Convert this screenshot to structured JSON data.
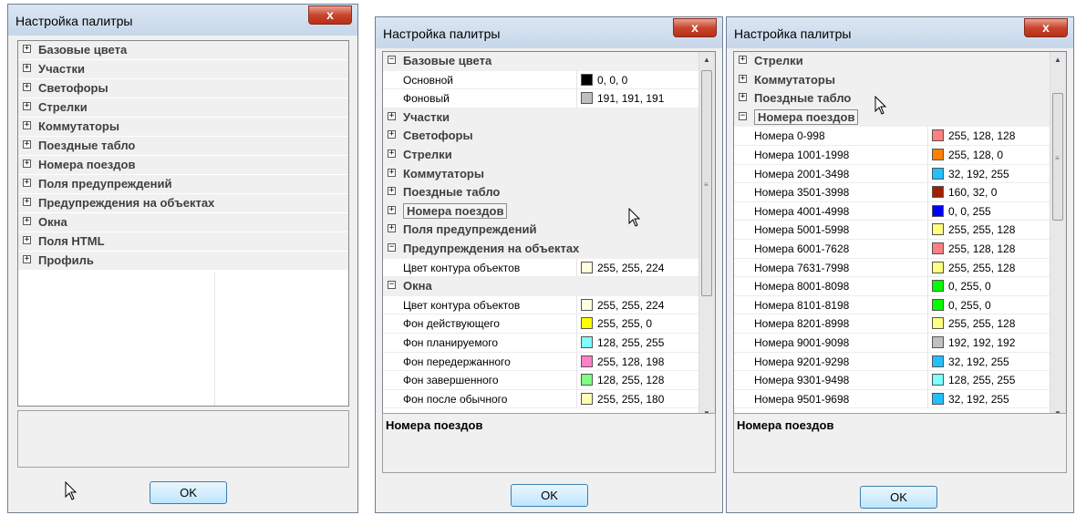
{
  "colors": {
    "title_bg": "#c6d7ea",
    "close_bg": "#c9452d",
    "button_bg": "#bee6fd",
    "panel_bg": "#f0f0f0"
  },
  "dialogs": [
    {
      "title": "Настройка палитры",
      "close_label": "x",
      "ok_label": "OK",
      "description": "",
      "categories": [
        "Базовые цвета",
        "Участки",
        "Светофоры",
        "Стрелки",
        "Коммутаторы",
        "Поездные табло",
        "Номера поездов",
        "Поля предупреждений",
        "Предупреждения на объектах",
        "Окна",
        "Поля HTML",
        "Профиль"
      ]
    },
    {
      "title": "Настройка палитры",
      "close_label": "x",
      "ok_label": "OK",
      "description": "Номера поездов",
      "rows": [
        {
          "type": "cat",
          "sign": "−",
          "label": "Базовые цвета"
        },
        {
          "type": "prop",
          "label": "Основной",
          "swatch": "#000000",
          "value": "0, 0, 0"
        },
        {
          "type": "prop",
          "label": "Фоновый",
          "swatch": "#bfbfbf",
          "value": "191, 191, 191"
        },
        {
          "type": "cat",
          "sign": "+",
          "label": "Участки"
        },
        {
          "type": "cat",
          "sign": "+",
          "label": "Светофоры"
        },
        {
          "type": "cat",
          "sign": "+",
          "label": "Стрелки"
        },
        {
          "type": "cat",
          "sign": "+",
          "label": "Коммутаторы"
        },
        {
          "type": "cat",
          "sign": "+",
          "label": "Поездные табло"
        },
        {
          "type": "cat",
          "sign": "+",
          "label": "Номера поездов",
          "selected": true
        },
        {
          "type": "cat",
          "sign": "+",
          "label": "Поля предупреждений"
        },
        {
          "type": "cat",
          "sign": "−",
          "label": "Предупреждения на объектах"
        },
        {
          "type": "prop",
          "label": "Цвет контура объектов",
          "swatch": "#ffffe0",
          "value": "255, 255, 224"
        },
        {
          "type": "cat",
          "sign": "−",
          "label": "Окна"
        },
        {
          "type": "prop",
          "label": "Цвет контура объектов",
          "swatch": "#ffffe0",
          "value": "255, 255, 224"
        },
        {
          "type": "prop",
          "label": "Фон действующего",
          "swatch": "#ffff00",
          "value": "255, 255, 0"
        },
        {
          "type": "prop",
          "label": "Фон планируемого",
          "swatch": "#80ffff",
          "value": "128, 255, 255"
        },
        {
          "type": "prop",
          "label": "Фон передержанного",
          "swatch": "#ff80c6",
          "value": "255, 128, 198"
        },
        {
          "type": "prop",
          "label": "Фон завершенного",
          "swatch": "#80ff80",
          "value": "128, 255, 128"
        },
        {
          "type": "prop",
          "label": "Фон после обычного",
          "swatch": "#ffffb4",
          "value": "255, 255, 180"
        }
      ]
    },
    {
      "title": "Настройка палитры",
      "close_label": "x",
      "ok_label": "OK",
      "description": "Номера поездов",
      "rows": [
        {
          "type": "cat",
          "sign": "+",
          "label": "Стрелки"
        },
        {
          "type": "cat",
          "sign": "+",
          "label": "Коммутаторы"
        },
        {
          "type": "cat",
          "sign": "+",
          "label": "Поездные табло"
        },
        {
          "type": "cat",
          "sign": "−",
          "label": "Номера поездов",
          "selected": true
        },
        {
          "type": "prop",
          "label": "Номера 0-998",
          "swatch": "#ff8080",
          "value": "255, 128, 128"
        },
        {
          "type": "prop",
          "label": "Номера 1001-1998",
          "swatch": "#ff8000",
          "value": "255, 128, 0"
        },
        {
          "type": "prop",
          "label": "Номера 2001-3498",
          "swatch": "#20c0ff",
          "value": "32, 192, 255"
        },
        {
          "type": "prop",
          "label": "Номера 3501-3998",
          "swatch": "#a02000",
          "value": "160, 32, 0"
        },
        {
          "type": "prop",
          "label": "Номера 4001-4998",
          "swatch": "#0000ff",
          "value": "0, 0, 255"
        },
        {
          "type": "prop",
          "label": "Номера 5001-5998",
          "swatch": "#ffff80",
          "value": "255, 255, 128"
        },
        {
          "type": "prop",
          "label": "Номера 6001-7628",
          "swatch": "#ff8080",
          "value": "255, 128, 128"
        },
        {
          "type": "prop",
          "label": "Номера 7631-7998",
          "swatch": "#ffff80",
          "value": "255, 255, 128"
        },
        {
          "type": "prop",
          "label": "Номера 8001-8098",
          "swatch": "#00ff00",
          "value": "0, 255, 0"
        },
        {
          "type": "prop",
          "label": "Номера 8101-8198",
          "swatch": "#00ff00",
          "value": "0, 255, 0"
        },
        {
          "type": "prop",
          "label": "Номера 8201-8998",
          "swatch": "#ffff80",
          "value": "255, 255, 128"
        },
        {
          "type": "prop",
          "label": "Номера 9001-9098",
          "swatch": "#c0c0c0",
          "value": "192, 192, 192"
        },
        {
          "type": "prop",
          "label": "Номера 9201-9298",
          "swatch": "#20c0ff",
          "value": "32, 192, 255"
        },
        {
          "type": "prop",
          "label": "Номера 9301-9498",
          "swatch": "#80ffff",
          "value": "128, 255, 255"
        },
        {
          "type": "prop",
          "label": "Номера 9501-9698",
          "swatch": "#20c0ff",
          "value": "32, 192, 255"
        }
      ]
    }
  ]
}
